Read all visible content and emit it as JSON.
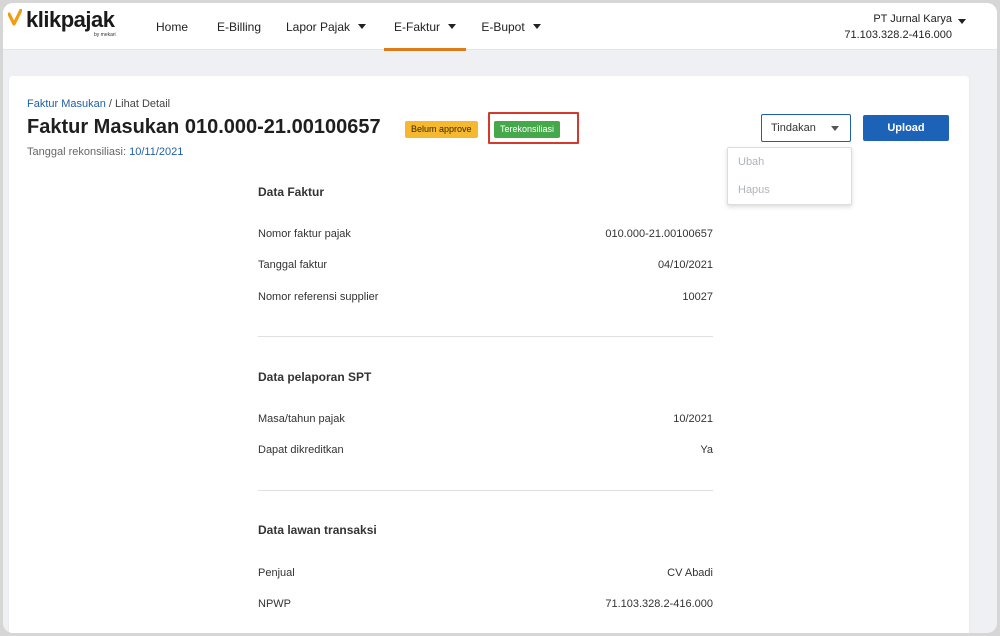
{
  "brand": {
    "name": "klikpajak",
    "sub": "by mekari",
    "accent": "#f39c12"
  },
  "nav": {
    "items": [
      {
        "label": "Home",
        "dropdown": false
      },
      {
        "label": "E-Billing",
        "dropdown": false
      },
      {
        "label": "Lapor Pajak",
        "dropdown": true
      },
      {
        "label": "E-Faktur",
        "dropdown": true,
        "active": true
      },
      {
        "label": "E-Bupot",
        "dropdown": true
      }
    ],
    "company_name": "PT Jurnal Karya",
    "company_npwp": "71.103.328.2-416.000"
  },
  "header": {
    "breadcrumb_link": "Faktur Masukan",
    "breadcrumb_sep": " / ",
    "breadcrumb_current": "Lihat Detail",
    "title": "Faktur Masukan 010.000-21.00100657",
    "badge_status": "Belum approve",
    "badge_recon": "Terekonsiliasi",
    "recon_label": "Tanggal rekonsiliasi: ",
    "recon_date": "10/11/2021"
  },
  "actions": {
    "tindakan_label": "Tindakan",
    "upload_label": "Upload",
    "menu": [
      "Ubah",
      "Hapus"
    ]
  },
  "sections": {
    "faktur": {
      "title": "Data Faktur",
      "rows": [
        {
          "label": "Nomor faktur pajak",
          "value": "010.000-21.00100657"
        },
        {
          "label": "Tanggal faktur",
          "value": "04/10/2021"
        },
        {
          "label": "Nomor referensi supplier",
          "value": "10027"
        }
      ]
    },
    "spt": {
      "title": "Data pelaporan SPT",
      "rows": [
        {
          "label": "Masa/tahun pajak",
          "value": "10/2021"
        },
        {
          "label": "Dapat dikreditkan",
          "value": "Ya"
        }
      ]
    },
    "lawan": {
      "title": "Data lawan transaksi",
      "rows": [
        {
          "label": "Penjual",
          "value": "CV Abadi"
        },
        {
          "label": "NPWP",
          "value": "71.103.328.2-416.000"
        }
      ]
    }
  }
}
